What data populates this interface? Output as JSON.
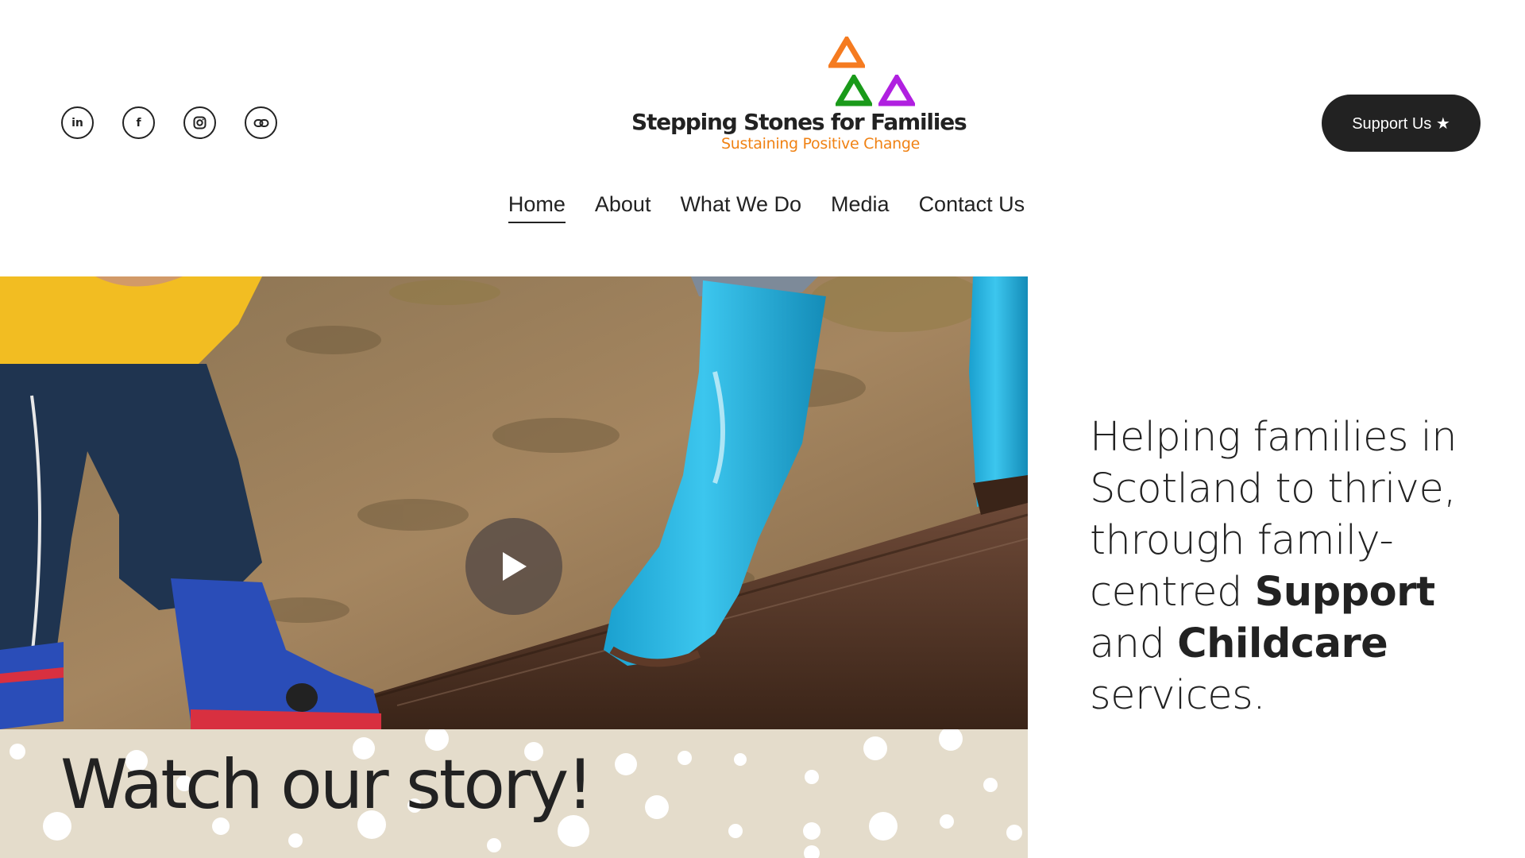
{
  "header": {
    "socials": [
      {
        "name": "linkedin-icon",
        "glyph": "in"
      },
      {
        "name": "facebook-icon",
        "glyph": "f"
      },
      {
        "name": "instagram-icon",
        "glyph": ""
      },
      {
        "name": "link-icon",
        "glyph": ""
      }
    ],
    "logo": {
      "name": "Stepping Stones for Families",
      "tagline": "Sustaining Positive Change",
      "colors": {
        "top": "#f57b20",
        "left": "#1a9a1a",
        "right": "#b020e0"
      }
    },
    "support_button": "Support Us ★"
  },
  "nav": {
    "items": [
      "Home",
      "About",
      "What We Do",
      "Media",
      "Contact Us"
    ],
    "active": "Home"
  },
  "hero": {
    "play_icon": "play-icon",
    "story_title": "Watch our story!"
  },
  "blurb": {
    "line1": "Helping families in Scotland to thrive, through family-centred",
    "bold1": "Support",
    "and": "and",
    "bold2": "Childcare",
    "end": "services."
  },
  "colors": {
    "button_bg": "#222222",
    "story_band": "#e4dccb",
    "tagline": "#f08214"
  }
}
